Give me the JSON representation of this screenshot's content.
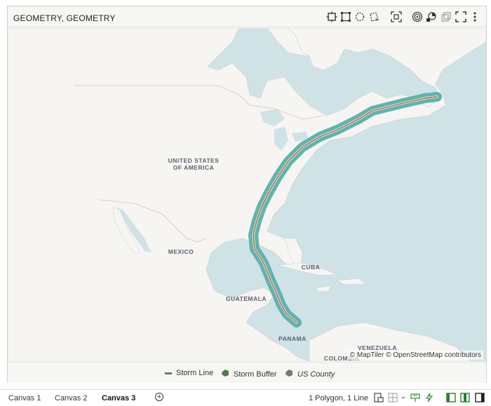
{
  "panel": {
    "title": "GEOMETRY, GEOMETRY"
  },
  "toolbar": {
    "icons": [
      "zoom-to-fit-icon",
      "rectangle-select-icon",
      "lasso-select-icon",
      "polygon-select-icon",
      "focus-icon",
      "layers-icon",
      "heatmap-icon",
      "duplicate-icon",
      "maximize-icon",
      "more-icon"
    ]
  },
  "map": {
    "labels": {
      "usa": "UNITED STATES\nOF AMERICA",
      "mexico": "MEXICO",
      "cuba": "CUBA",
      "guatemala": "GUATEMALA",
      "panama": "PANAMA",
      "venezuela": "VENEZUELA",
      "colombia": "COLOMBIA"
    },
    "attribution": "© MapTiler © OpenStreetMap contributors",
    "colors": {
      "water": "#cfe2e6",
      "land": "#f6f5f2",
      "buffer": "#5fb3b0",
      "line": "#9a6a3c"
    }
  },
  "legend": {
    "items": [
      {
        "label": "Storm Line",
        "color": "#5a8a5a"
      },
      {
        "label": "Storm Buffer",
        "color": "#4f7c4f"
      },
      {
        "label": "US County",
        "color": "#777777"
      }
    ]
  },
  "tabs": [
    "Canvas 1",
    "Canvas 2",
    "Canvas 3"
  ],
  "active_tab": "Canvas 3",
  "status": "1 Polygon, 1 Line"
}
